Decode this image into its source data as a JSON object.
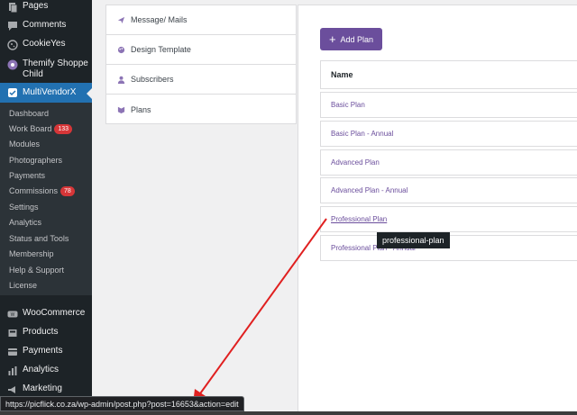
{
  "sidebar": {
    "top_items": [
      {
        "label": "Pages",
        "icon": "pages-icon"
      },
      {
        "label": "Comments",
        "icon": "comments-icon"
      },
      {
        "label": "CookieYes",
        "icon": "cookie-icon"
      },
      {
        "label": "Themify Shoppe Child",
        "icon": "themify-icon"
      }
    ],
    "active_item": {
      "label": "MultiVendorX",
      "icon": "multivendorx-icon"
    },
    "submenu": [
      {
        "label": "Dashboard"
      },
      {
        "label": "Work Board",
        "badge": "133"
      },
      {
        "label": "Modules"
      },
      {
        "label": "Photographers"
      },
      {
        "label": "Payments"
      },
      {
        "label": "Commissions",
        "badge": "78"
      },
      {
        "label": "Settings"
      },
      {
        "label": "Analytics"
      },
      {
        "label": "Status and Tools"
      },
      {
        "label": "Membership"
      },
      {
        "label": "Help & Support"
      },
      {
        "label": "License"
      }
    ],
    "bottom_items": [
      {
        "label": "WooCommerce",
        "icon": "woocommerce-icon"
      },
      {
        "label": "Products",
        "icon": "products-icon"
      },
      {
        "label": "Payments",
        "icon": "payments-icon"
      },
      {
        "label": "Analytics",
        "icon": "analytics-icon"
      },
      {
        "label": "Marketing",
        "icon": "marketing-icon"
      }
    ]
  },
  "settings_nav": [
    {
      "label": "Message/ Mails",
      "icon": "send-icon"
    },
    {
      "label": "Design Template",
      "icon": "palette-icon"
    },
    {
      "label": "Subscribers",
      "icon": "user-icon"
    },
    {
      "label": "Plans",
      "icon": "plans-icon"
    }
  ],
  "plans_panel": {
    "add_button": "Add Plan",
    "column_header": "Name",
    "plans": [
      "Basic Plan",
      "Basic Plan - Annual",
      "Advanced Plan",
      "Advanced Plan - Annual",
      "Professional Plan",
      "Professional Plan - Annual"
    ],
    "hovered_plan": "Professional Plan"
  },
  "tooltip": "professional-plan",
  "status_url": "https://picflick.co.za/wp-admin/post.php?post=16653&action=edit",
  "colors": {
    "sidebar_bg": "#1d2327",
    "active_bg": "#2271b1",
    "accent_purple": "#6b4e9c",
    "badge_red": "#d63638",
    "annotation_arrow": "#e02020"
  }
}
